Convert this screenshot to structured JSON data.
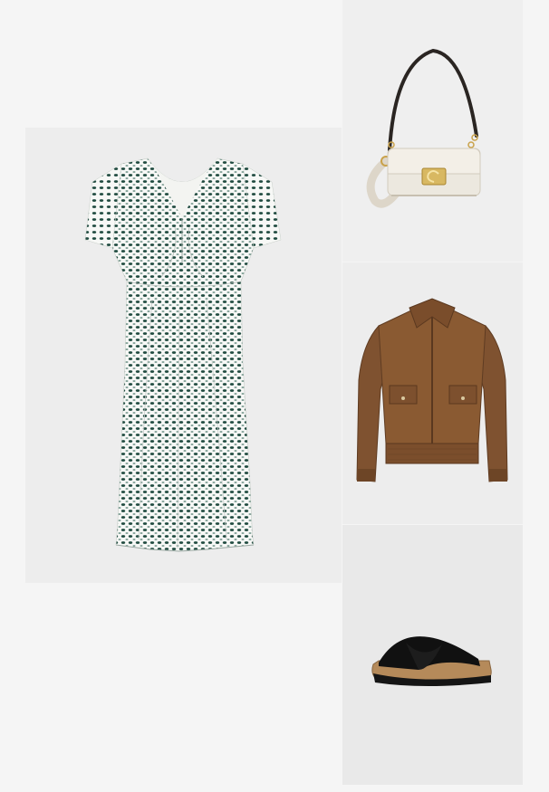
{
  "collage": {
    "items": [
      {
        "name": "dress",
        "pattern_colors": [
          "#ffffff",
          "#1f4a3f"
        ]
      },
      {
        "name": "shoulder-bag",
        "body_color": "#ece8df",
        "hardware_color": "#c9a24a",
        "strap_color": "#2a2522"
      },
      {
        "name": "suede-jacket",
        "color": "#8a5a32"
      },
      {
        "name": "cross-strap-sandal",
        "upper_color": "#111111",
        "sole_color": "#b58a5a"
      }
    ]
  }
}
